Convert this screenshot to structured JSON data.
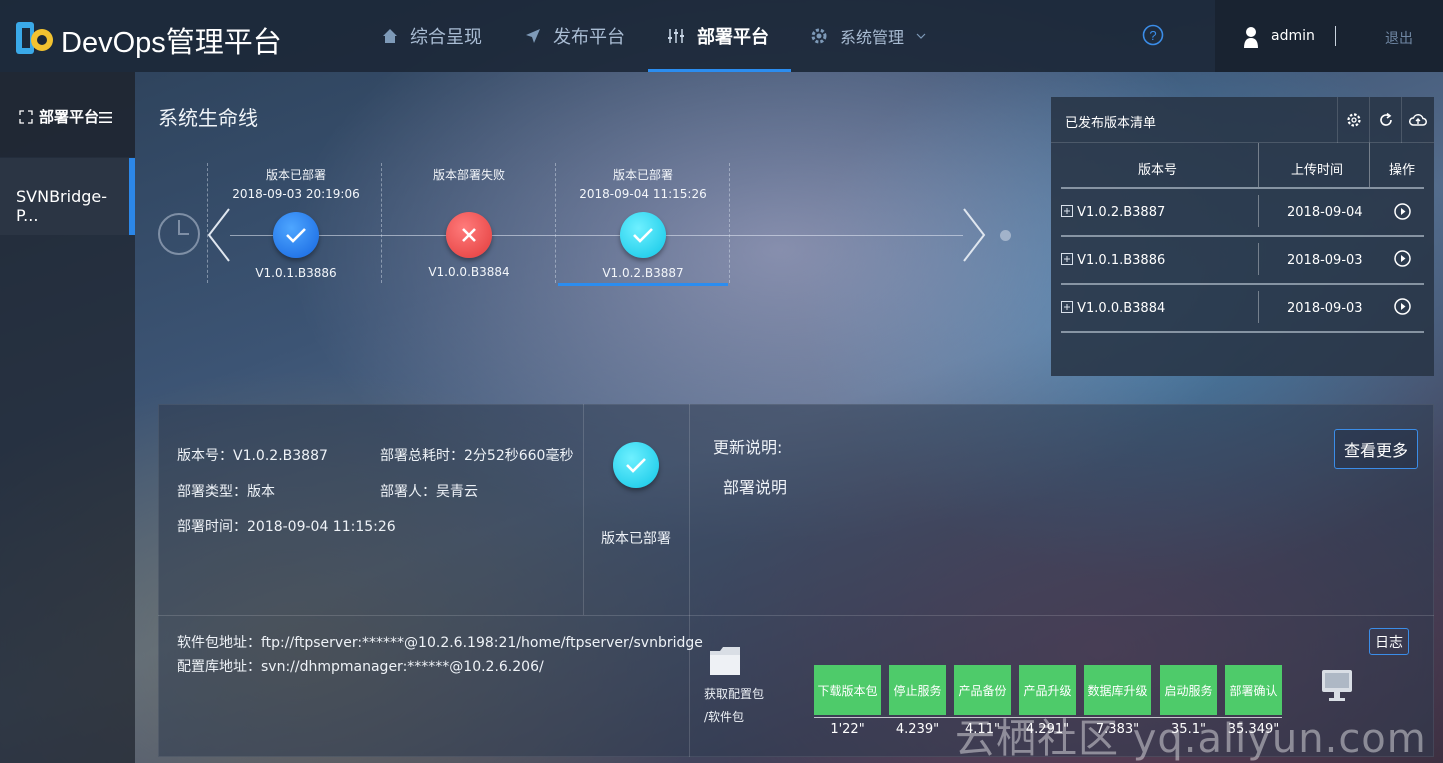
{
  "header": {
    "brand": "DevOps管理平台",
    "nav": [
      {
        "label": "综合呈现",
        "icon": "home-icon"
      },
      {
        "label": "发布平台",
        "icon": "send-icon"
      },
      {
        "label": "部署平台",
        "icon": "sliders-icon",
        "active": true
      },
      {
        "label": "系统管理",
        "icon": "gear-icon"
      }
    ],
    "username": "admin",
    "logout": "退出"
  },
  "sidebar": {
    "header": "部署平台",
    "items": [
      {
        "label": "SVNBridge-P..."
      }
    ]
  },
  "timeline": {
    "title": "系统生命线",
    "nodes": [
      {
        "status": "版本已部署",
        "time": "2018-09-03 20:19:06",
        "version": "V1.0.1.B3886",
        "state": "success"
      },
      {
        "status": "版本部署失败",
        "time": "",
        "version": "V1.0.0.B3884",
        "state": "failed"
      },
      {
        "status": "版本已部署",
        "time": "2018-09-04 11:15:26",
        "version": "V1.0.2.B3887",
        "state": "current"
      }
    ]
  },
  "release_list": {
    "title": "已发布版本清单",
    "columns": [
      "版本号",
      "上传时间",
      "操作"
    ],
    "rows": [
      {
        "version": "V1.0.2.B3887",
        "date": "2018-09-04"
      },
      {
        "version": "V1.0.1.B3886",
        "date": "2018-09-03"
      },
      {
        "version": "V1.0.0.B3884",
        "date": "2018-09-03"
      }
    ]
  },
  "detail": {
    "version": "版本号：V1.0.2.B3887",
    "duration": "部署总耗时：2分52秒660毫秒",
    "type": "部署类型：版本",
    "deployer": "部署人：吴青云",
    "time": "部署时间：2018-09-04 11:15:26",
    "status": "版本已部署",
    "notes_title": "更新说明:",
    "notes_body": "部署说明",
    "more_button": "查看更多",
    "package_addr": "软件包地址：ftp://ftpserver:******@10.2.6.198:21/home/ftpserver/svnbridge",
    "config_addr": "配置库地址：svn://dhmpmanager:******@10.2.6.206/",
    "fetch_label_1": "获取配置包",
    "fetch_label_2": "/软件包",
    "log_button": "日志",
    "steps": [
      {
        "label": "下载版本包",
        "time": "1'22\""
      },
      {
        "label": "停止服务",
        "time": "4.239\""
      },
      {
        "label": "产品备份",
        "time": "4.11\""
      },
      {
        "label": "产品升级",
        "time": "4.291\""
      },
      {
        "label": "数据库升级",
        "time": "7.383\""
      },
      {
        "label": "启动服务",
        "time": "35.1\""
      },
      {
        "label": "部署确认",
        "time": "35.349\""
      }
    ]
  },
  "watermark": "云栖社区 yq.aliyun.com",
  "colors": {
    "accent": "#2b8df0",
    "success": "#4ecb6a",
    "failed": "#f05a5a",
    "current": "#1fd3f0"
  }
}
